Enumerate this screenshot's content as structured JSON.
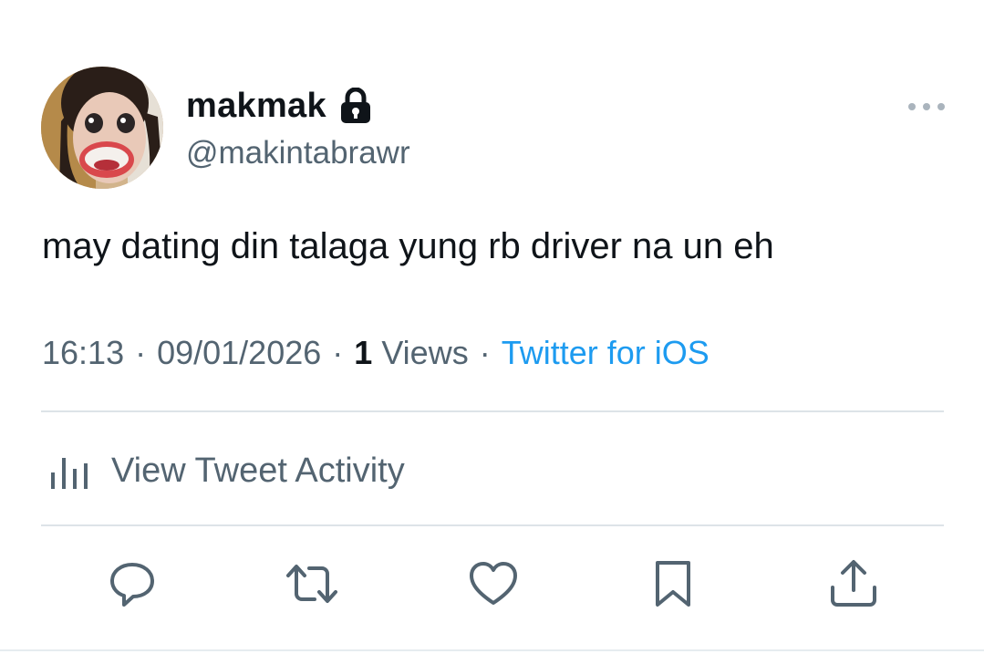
{
  "author": {
    "display_name": "makmak",
    "handle": "@makintabrawr",
    "avatar_icon": "user-avatar-photo",
    "protected_icon": "lock-icon"
  },
  "tweet": {
    "text": "may dating din talaga yung rb driver na un eh",
    "time": "16:13",
    "date": "09/01/2026",
    "views_count": "1",
    "views_label": "Views",
    "separator": "·",
    "source": "Twitter for iOS"
  },
  "activity": {
    "label": "View Tweet Activity",
    "icon": "analytics-bars-icon"
  },
  "actions": {
    "reply_icon": "reply-icon",
    "retweet_icon": "retweet-icon",
    "like_icon": "heart-icon",
    "bookmark_icon": "bookmark-icon",
    "share_icon": "share-icon"
  },
  "colors": {
    "text_primary": "#0f1419",
    "text_secondary": "#536471",
    "link": "#1d9bf0",
    "icon_gray": "#536471",
    "divider": "#dde3e8"
  }
}
